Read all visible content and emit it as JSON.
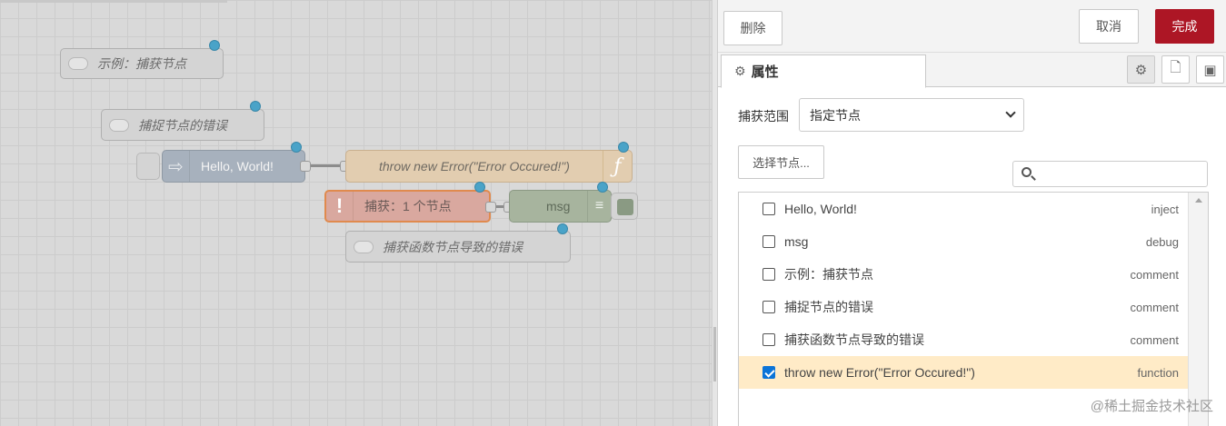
{
  "canvas": {
    "comment_example": "示例：捕获节点",
    "comment_catch_errors": "捕捉节点的错误",
    "comment_function_errors": "捕获函数节点导致的错误",
    "inject_label": "Hello, World!",
    "function_label": "throw new Error(\"Error Occured!\")",
    "catch_label": "捕获：1 个节点",
    "debug_label": "msg"
  },
  "toolbar": {
    "delete_label": "删除",
    "cancel_label": "取消",
    "done_label": "完成"
  },
  "tabs": {
    "properties_label": "属性"
  },
  "form": {
    "scope_label": "捕获范围",
    "scope_value": "指定节点",
    "select_nodes_label": "选择节点...",
    "search_placeholder": ""
  },
  "node_list": [
    {
      "name": "Hello, World!",
      "type": "inject",
      "checked": false
    },
    {
      "name": "msg",
      "type": "debug",
      "checked": false
    },
    {
      "name": "示例：捕获节点",
      "type": "comment",
      "checked": false
    },
    {
      "name": "捕捉节点的错误",
      "type": "comment",
      "checked": false
    },
    {
      "name": "捕获函数节点导致的错误",
      "type": "comment",
      "checked": false
    },
    {
      "name": "throw new Error(\"Error Occured!\")",
      "type": "function",
      "checked": true
    }
  ],
  "watermark": "@稀土掘金技术社区",
  "colors": {
    "primary": "#ad1625",
    "selected_row": "#ffebc7",
    "status_dot": "#4aa3c8",
    "catch_border": "#e08a4e"
  }
}
